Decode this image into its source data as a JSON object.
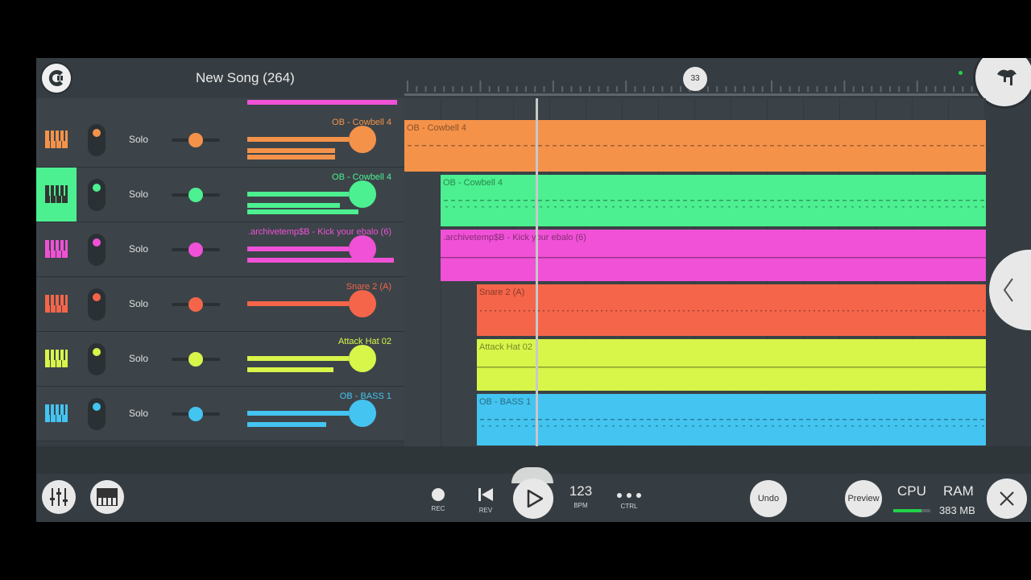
{
  "header": {
    "song_title": "New Song (264)",
    "marker": "33"
  },
  "tracks": [
    {
      "name": "OB - Cowbell 4",
      "solo": "Solo",
      "color": "#f5924a",
      "vol": 0.67,
      "extra": [
        0.6,
        0.6
      ],
      "selected": false
    },
    {
      "name": "OB - Cowbell 4",
      "solo": "Solo",
      "color": "#4cf090",
      "vol": 0.67,
      "extra": [
        0.63,
        0.76
      ],
      "selected": true
    },
    {
      "name": ".archivetemp$B - Kick your ebalo (6)",
      "solo": "Solo",
      "color": "#f051d6",
      "vol": 0.67,
      "extra": [
        1.0,
        0.0
      ],
      "selected": false
    },
    {
      "name": "Snare 2 (A)",
      "solo": "Solo",
      "color": "#f5654a",
      "vol": 0.67,
      "extra": [
        0.0,
        0.0
      ],
      "selected": false
    },
    {
      "name": "Attack Hat 02",
      "solo": "Solo",
      "color": "#d8f54a",
      "vol": 0.67,
      "extra": [
        0.59,
        0.0
      ],
      "selected": false
    },
    {
      "name": "OB - BASS 1",
      "solo": "Solo",
      "color": "#44c4f0",
      "vol": 0.67,
      "extra": [
        0.54,
        0.0
      ],
      "selected": false
    }
  ],
  "clips": [
    {
      "label": "OB - Cowbell 4",
      "color": "#f5924a",
      "start": 0.0,
      "end": 1.0
    },
    {
      "label": "OB - Cowbell 4",
      "color": "#4cf090",
      "start": 0.062,
      "end": 1.0
    },
    {
      "label": ".archivetemp$B - Kick your ebalo (6)",
      "color": "#f051d6",
      "start": 0.062,
      "end": 1.0
    },
    {
      "label": "Snare 2 (A)",
      "color": "#f5654a",
      "start": 0.125,
      "end": 1.0
    },
    {
      "label": "Attack Hat 02",
      "color": "#d8f54a",
      "start": 0.125,
      "end": 1.0
    },
    {
      "label": "OB - BASS 1",
      "color": "#44c4f0",
      "start": 0.125,
      "end": 1.0
    }
  ],
  "transport": {
    "rec": "REC",
    "rev": "REV",
    "bpm": "123",
    "bpm_label": "BPM",
    "ctrl": "CTRL",
    "undo": "Undo",
    "preview": "Preview",
    "cpu": "CPU",
    "cpu_level": 0.75,
    "ram": "RAM",
    "ram_value": "383 MB"
  }
}
